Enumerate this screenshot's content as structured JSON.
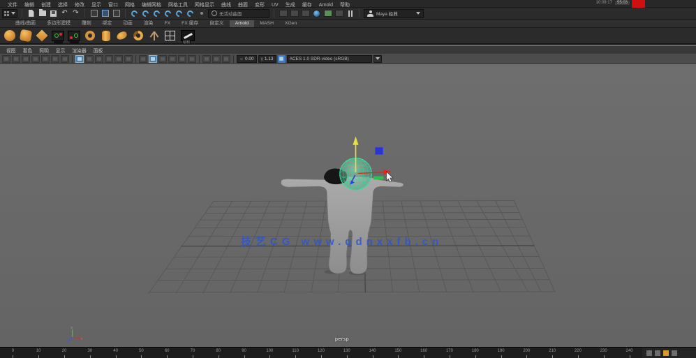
{
  "menubar": {
    "items": [
      "文件",
      "编辑",
      "创建",
      "选择",
      "修改",
      "显示",
      "窗口",
      "网格",
      "编辑网格",
      "网格工具",
      "网格显示",
      "曲线",
      "曲面",
      "变形",
      "UV",
      "生成",
      "缓存",
      "Arnold",
      "帮助"
    ],
    "recorder_time": "10:09:17",
    "recorder_label": "55:03"
  },
  "statusline": {
    "live_surface": "无活动曲面",
    "workspace": "Maya 经典",
    "undo_glyph": "↶",
    "redo_glyph": "↷",
    "icons": [
      "menuset-dropdown",
      "new-scene",
      "open-scene",
      "save-scene",
      "undo",
      "redo",
      "select-hierarchy",
      "select-object",
      "select-component",
      "snap-to-grid",
      "snap-to-curve",
      "snap-to-point",
      "snap-to-projected-center",
      "snap-to-view-plane",
      "make-live",
      "render-view",
      "render-frame",
      "ipr-render",
      "render-settings",
      "hypershade",
      "light-editor",
      "pause-viewport",
      "workspace-dropdown"
    ]
  },
  "shelf": {
    "tabs": [
      {
        "label": "曲线/曲面"
      },
      {
        "label": "多边形建模"
      },
      {
        "label": "雕刻"
      },
      {
        "label": "绑定"
      },
      {
        "label": "动画"
      },
      {
        "label": "渲染"
      },
      {
        "label": "FX"
      },
      {
        "label": "FX 缓存"
      },
      {
        "label": "自定义"
      },
      {
        "label": "Arnold",
        "active": true
      },
      {
        "label": "MASH"
      },
      {
        "label": "XGen"
      }
    ],
    "scroll_glyph": "«",
    "pencil_label": "绘制",
    "icons": [
      "poly-sphere",
      "poly-sphere-faceted",
      "poly-plane",
      "joint-tool",
      "ik-handle-tool",
      "nurbs-circle",
      "poly-cylinder",
      "poly-bean",
      "poly-helix",
      "paint-effects-tree",
      "uv-grid",
      "pencil-tool"
    ]
  },
  "panel": {
    "menus": [
      "视图",
      "着色",
      "照明",
      "显示",
      "渲染器",
      "面板"
    ],
    "exposure": "0.00",
    "gamma": "1.13",
    "gain_glyph": "γ",
    "exposure_glyph": "☼",
    "transform_glyph": "▦",
    "view_transform": "ACES 1.0 SDR-video (sRGB)",
    "icons": [
      "select-camera",
      "lock-camera",
      "camera-attributes",
      "bookmarks",
      "image-plane",
      "2d-pan-zoom",
      "grease-pencil",
      "wireframe-mode",
      "shaded-mode",
      "textured-mode",
      "use-all-lights",
      "shadows",
      "screen-space-ao",
      "motion-blur",
      "multisample-aa",
      "depth-of-field",
      "isolate-select",
      "x-ray",
      "exposure-field",
      "gamma-field",
      "color-managed",
      "view-transform-dropdown"
    ]
  },
  "viewport": {
    "watermark": "技艺CG www.qdnxxfb.cn",
    "camera_label": "persp",
    "axis_x": "x",
    "axis_y": "y",
    "axis_z": "z"
  },
  "timeline": {
    "ticks": [
      "0",
      "10",
      "20",
      "30",
      "40",
      "50",
      "60",
      "70",
      "80",
      "90",
      "100",
      "110",
      "120",
      "130",
      "140",
      "150",
      "160",
      "170",
      "180",
      "190",
      "200",
      "210",
      "220",
      "230",
      "240"
    ]
  },
  "colors": {
    "manipulator_y": "#e8e040",
    "manipulator_x": "#dd2a1a",
    "manipulator_z": "#2a43e0",
    "controller_wire": "#35d493",
    "watermark_blue": "#2e55cf",
    "record_red": "#d01010",
    "shelf_orange": "#d69440"
  }
}
